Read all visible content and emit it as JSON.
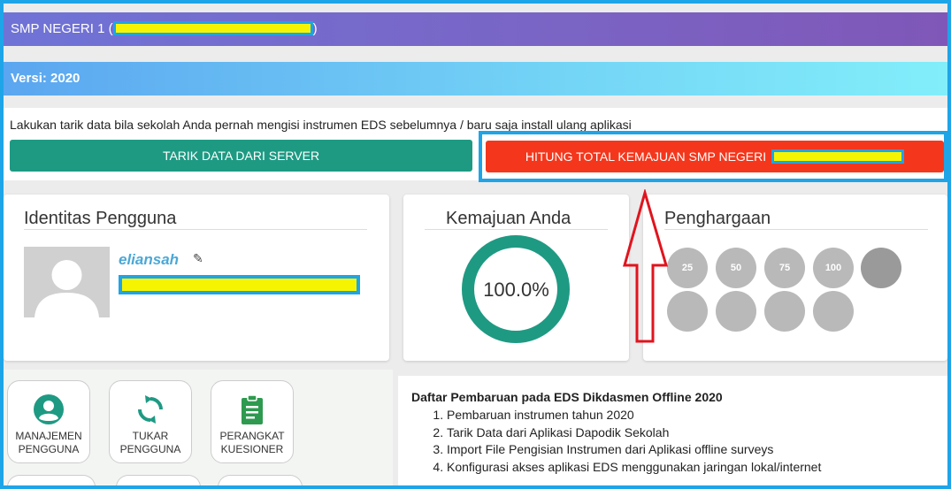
{
  "header": {
    "school_prefix": "SMP NEGERI 1 (",
    "school_suffix": ")"
  },
  "version": {
    "label": "Versi: 2020"
  },
  "notice": {
    "text": "Lakukan tarik data bila sekolah Anda pernah mengisi instrumen EDS sebelumnya / baru saja install ulang aplikasi",
    "pull_button": "TARIK DATA DARI SERVER",
    "calc_button": "HITUNG TOTAL KEMAJUAN SMP NEGERI"
  },
  "identity": {
    "title": "Identitas Pengguna",
    "username": "eliansah"
  },
  "progress": {
    "title": "Kemajuan Anda",
    "value_label": "100.0%",
    "fraction": 1.0
  },
  "awards": {
    "title": "Penghargaan",
    "badges": [
      {
        "icon": "trophy-25-icon",
        "text": "25"
      },
      {
        "icon": "trophy-50-icon",
        "text": "50"
      },
      {
        "icon": "trophy-75-icon",
        "text": "75"
      },
      {
        "icon": "medal-100-icon",
        "text": "100"
      },
      {
        "icon": "runner-icon",
        "text": ""
      },
      {
        "icon": "checklist-3-icon",
        "text": ""
      },
      {
        "icon": "checklist-7-icon",
        "text": ""
      },
      {
        "icon": "lamp-icon",
        "text": ""
      },
      {
        "icon": "thumbs-up-icon",
        "text": ""
      }
    ]
  },
  "menu": {
    "items": [
      {
        "icon": "account-circle-icon",
        "line1": "MANAJEMEN",
        "line2": "PENGGUNA",
        "color": "#1e9a83"
      },
      {
        "icon": "sync-icon",
        "line1": "TUKAR",
        "line2": "PENGGUNA",
        "color": "#1e9a83"
      },
      {
        "icon": "clipboard-icon",
        "line1": "PERANGKAT",
        "line2": "KUESIONER",
        "color": "#2e9a4f"
      }
    ]
  },
  "updates": {
    "title": "Daftar Pembaruan pada EDS Dikdasmen Offline 2020",
    "items": [
      "Pembaruan instrumen tahun 2020",
      "Tarik Data dari Aplikasi Dapodik Sekolah",
      "Import File Pengisian Instrumen dari Aplikasi offline surveys",
      "Konfigurasi akses aplikasi EDS menggunakan jaringan lokal/internet"
    ]
  },
  "colors": {
    "accent_teal": "#1e9a83",
    "accent_red": "#f4371c",
    "highlight_yellow": "#f6f400",
    "annotation_blue": "#1fa4e6",
    "arrow_red": "#e0141e"
  }
}
